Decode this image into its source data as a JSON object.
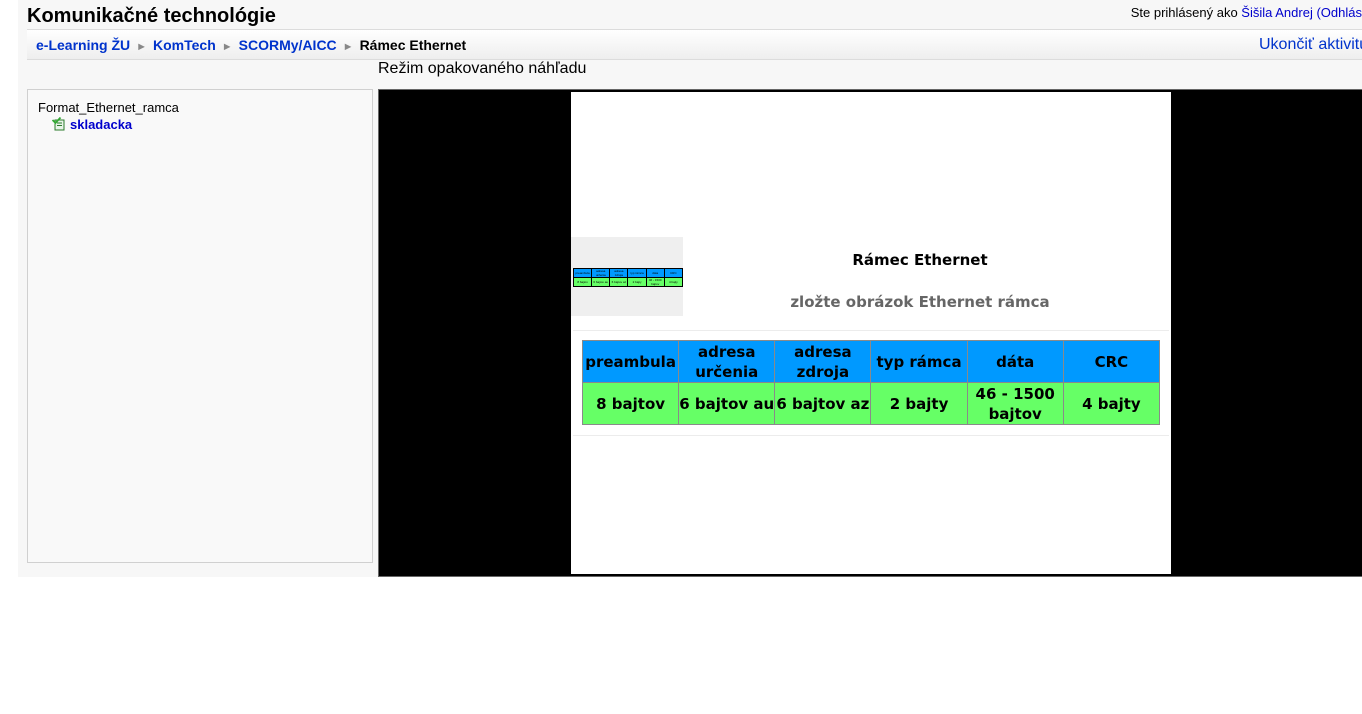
{
  "header": {
    "course_title": "Komunikačné technológie",
    "login_prefix": "Ste prihlásený ako ",
    "user_name": "Šišila Andrej",
    "logout_label": "(Odhlás"
  },
  "navbar": {
    "breadcrumb": [
      "e-Learning ŽU",
      "KomTech",
      "SCORMy/AICC",
      "Rámec Ethernet"
    ],
    "separator": "►",
    "end_activity": "Ukončiť aktivitu"
  },
  "mode_label": "Režim opakovaného náhľadu",
  "toc": {
    "title": "Format_Ethernet_ramca",
    "items": [
      {
        "label": "skladacka",
        "icon": "completed-check-icon"
      }
    ]
  },
  "slide": {
    "title": "Rámec Ethernet",
    "subtitle": "zložte obrázok Ethernet rámca",
    "table": {
      "headers": [
        "preambula",
        "adresa určenia",
        "adresa zdroja",
        "typ rámca",
        "dáta",
        "CRC"
      ],
      "values": [
        "8 bajtov",
        "6 bajtov au",
        "6 bajtov az",
        "2 bajty",
        "46 - 1500 bajtov",
        "4 bajty"
      ]
    }
  },
  "colors": {
    "link": "#0033cc",
    "header_cell": "#0099ff",
    "value_cell": "#66ff66",
    "player_background": "#000000"
  }
}
